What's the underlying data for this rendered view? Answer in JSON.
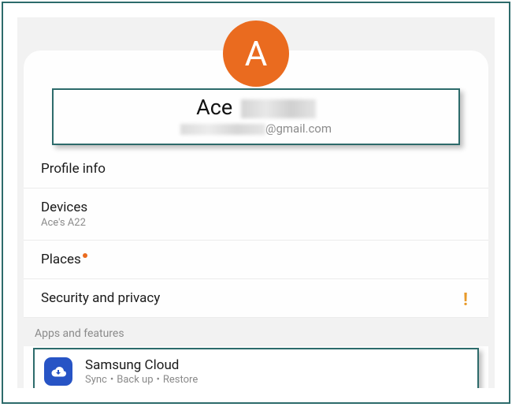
{
  "avatar": {
    "initial": "A"
  },
  "account": {
    "name_prefix": "Ace",
    "email_suffix": "@gmail.com"
  },
  "rows": {
    "profile": {
      "title": "Profile info"
    },
    "devices": {
      "title": "Devices",
      "subtitle": "Ace's A22"
    },
    "places": {
      "title": "Places"
    },
    "security": {
      "title": "Security and privacy",
      "alert": "!"
    }
  },
  "section": {
    "apps_features": "Apps and features"
  },
  "cloud": {
    "title": "Samsung Cloud",
    "sub1": "Sync",
    "sub2": "Back up",
    "sub3": "Restore"
  }
}
